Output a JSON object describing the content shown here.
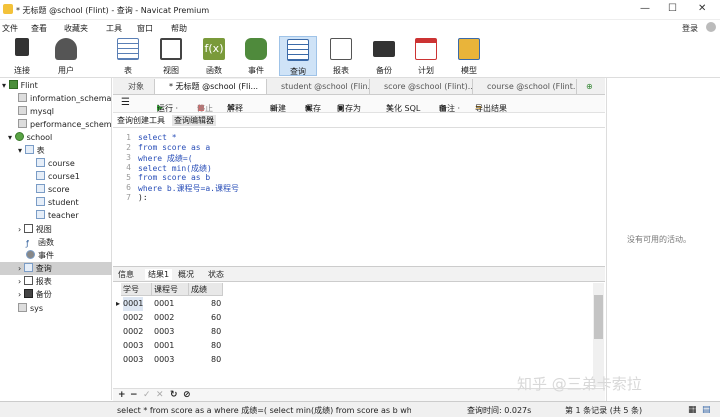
{
  "window": {
    "title": "* 无标题 @school (Flint) - 查询 - Navicat Premium"
  },
  "menu": [
    "文件",
    "查看",
    "收藏夹",
    "工具",
    "窗口",
    "帮助"
  ],
  "user": {
    "login": "登录"
  },
  "ribbon": [
    {
      "label": "连接",
      "icon": "plug-icon"
    },
    {
      "label": "用户",
      "icon": "user-icon"
    },
    {
      "label": "表",
      "icon": "table-icon"
    },
    {
      "label": "视图",
      "icon": "glasses-icon"
    },
    {
      "label": "函数",
      "icon": "function-icon"
    },
    {
      "label": "事件",
      "icon": "database-clock-icon"
    },
    {
      "label": "查询",
      "icon": "query-icon"
    },
    {
      "label": "报表",
      "icon": "report-icon"
    },
    {
      "label": "备份",
      "icon": "tape-icon"
    },
    {
      "label": "计划",
      "icon": "calendar-icon"
    },
    {
      "label": "模型",
      "icon": "model-icon"
    }
  ],
  "tree": {
    "root": "Flint",
    "dbs": [
      "information_schema",
      "mysql",
      "performance_schema"
    ],
    "school": "school",
    "tables_node": "表",
    "tables": [
      "course",
      "course1",
      "score",
      "student",
      "teacher"
    ],
    "others": [
      "视图",
      "函数",
      "事件",
      "查询",
      "报表",
      "备份"
    ],
    "sys": "sys"
  },
  "tabs": [
    "对象",
    "* 无标题 @school (Fli...",
    "student @school (Flin...",
    "score @school (Flint)...",
    "course @school (Flint..."
  ],
  "toolbar": {
    "run": "运行 ·",
    "stop": "停止",
    "explain": "解释",
    "new": "新建",
    "save": "保存",
    "saveas": "另存为",
    "beautify": "美化 SQL",
    "note": "备注 ·",
    "export": "导出结果"
  },
  "subtabs": [
    "查询创建工具",
    "查询编辑器"
  ],
  "editor": {
    "lines": [
      [
        "kw",
        "select *"
      ],
      [
        "kw",
        "from score as a"
      ],
      [
        "kw",
        "where 成绩=("
      ],
      [
        "kw",
        "select min(成绩)"
      ],
      [
        "kw",
        "from score as b"
      ],
      [
        "kw",
        "where b.课程号=a.课程号"
      ],
      [
        "",
        "):"
      ]
    ]
  },
  "result_tabs": [
    "信息",
    "结果1",
    "概况",
    "状态"
  ],
  "grid": {
    "headers": [
      "学号",
      "课程号",
      "成绩"
    ],
    "rows": [
      [
        "0001",
        "0001",
        "80"
      ],
      [
        "0002",
        "0002",
        "60"
      ],
      [
        "0002",
        "0003",
        "80"
      ],
      [
        "0003",
        "0001",
        "80"
      ],
      [
        "0003",
        "0003",
        "80"
      ]
    ]
  },
  "right": {
    "note": "没有可用的活动。"
  },
  "status": {
    "sql": "select * from score as a where 成绩=( select min(成绩) from score as b whe",
    "time": "查询时间: 0.027s",
    "records": "第 1 条记录 (共 5 条)"
  },
  "watermark": "知乎 @三弟卡索拉"
}
